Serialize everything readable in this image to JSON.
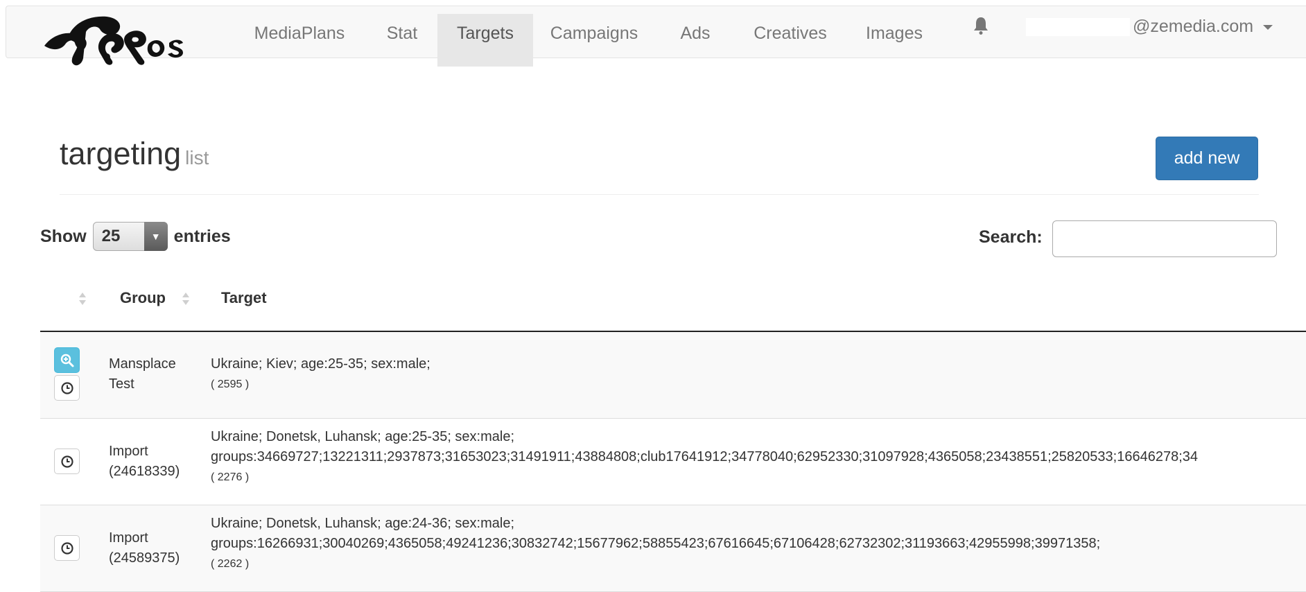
{
  "nav": {
    "items": [
      {
        "label": "MediaPlans",
        "active": false
      },
      {
        "label": "Stat",
        "active": false
      },
      {
        "label": "Targets",
        "active": true
      },
      {
        "label": "Campaigns",
        "active": false
      },
      {
        "label": "Ads",
        "active": false
      },
      {
        "label": "Creatives",
        "active": false
      },
      {
        "label": "Images",
        "active": false
      }
    ],
    "user_email": "@zemedia.com"
  },
  "page": {
    "title": "targeting",
    "subtitle": "list",
    "add_button": "add new"
  },
  "controls": {
    "show_label": "Show",
    "entries_value": "25",
    "entries_label": "entries",
    "search_label": "Search:",
    "search_value": ""
  },
  "table": {
    "columns": [
      "Group",
      "Target"
    ],
    "rows": [
      {
        "group": "Mansplace Test",
        "target_lines": [
          "Ukraine; Kiev; age:25-35; sex:male;"
        ],
        "count": "( 2595 )",
        "has_view": true
      },
      {
        "group": "Import (24618339)",
        "target_lines": [
          "Ukraine; Donetsk, Luhansk; age:25-35; sex:male;",
          "groups:34669727;13221311;2937873;31653023;31491911;43884808;club17641912;34778040;62952330;31097928;4365058;23438551;25820533;16646278;34"
        ],
        "count": "( 2276 )",
        "has_view": false
      },
      {
        "group": "Import (24589375)",
        "target_lines": [
          "Ukraine; Donetsk, Luhansk; age:24-36; sex:male;",
          "groups:16266931;30040269;4365058;49241236;30832742;15677962;58855423;67616645;67106428;62732302;31193663;42955998;39971358;"
        ],
        "count": "( 2262 )",
        "has_view": false
      }
    ]
  },
  "icons": {
    "bell": "bell-icon",
    "view": "zoom-in-icon",
    "history": "clock-icon",
    "dropdown": "triangle-down-icon",
    "sort": "sort-icon"
  },
  "colors": {
    "primary": "#337ab7",
    "info": "#5bc0de",
    "navbar_bg": "#f8f8f8",
    "nav_active_bg": "#e7e7e7"
  }
}
